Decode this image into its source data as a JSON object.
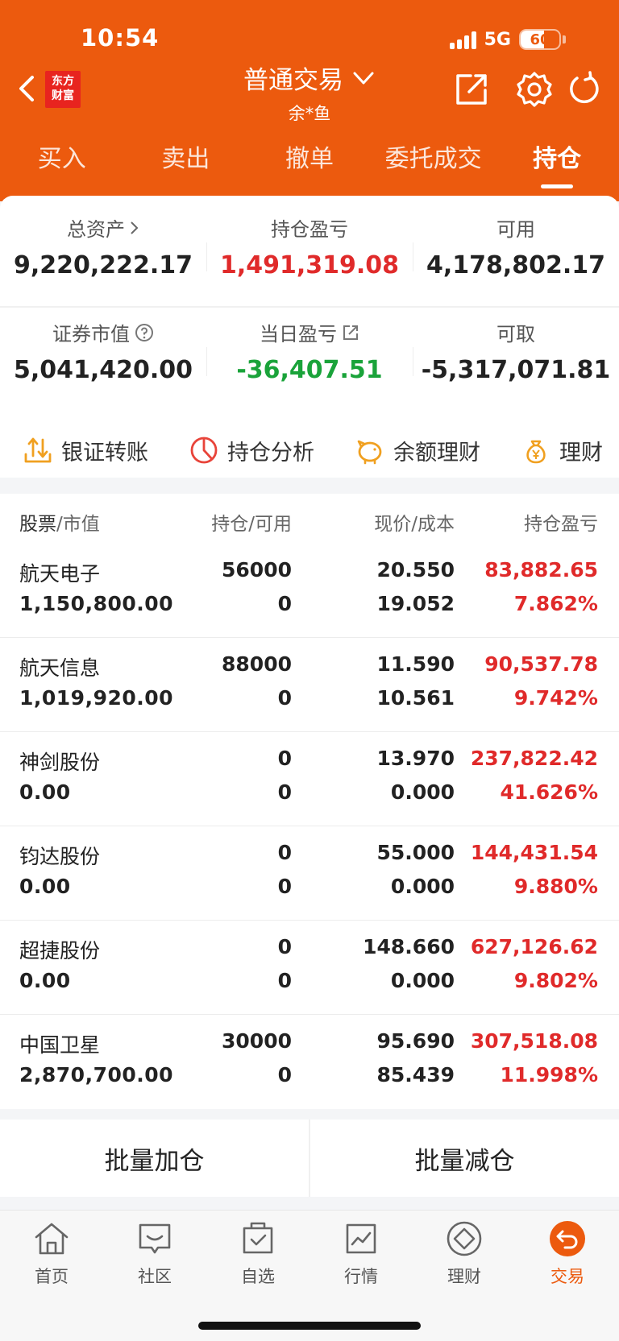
{
  "status": {
    "time": "10:54",
    "network": "5G",
    "battery": "60",
    "battery_fraction": 0.6
  },
  "header": {
    "logo_line1": "东方",
    "logo_line2": "财富",
    "title": "普通交易",
    "subtitle": "余*鱼",
    "icons": [
      "back-icon",
      "share-icon",
      "gear-icon",
      "refresh-icon"
    ]
  },
  "tabs": [
    {
      "label": "买入"
    },
    {
      "label": "卖出"
    },
    {
      "label": "撤单"
    },
    {
      "label": "委托成交"
    },
    {
      "label": "持仓",
      "active": true
    }
  ],
  "summary": {
    "total_assets_label": "总资产",
    "total_assets": "9,220,222.17",
    "position_pl_label": "持仓盈亏",
    "position_pl": "1,491,319.08",
    "available_label": "可用",
    "available": "4,178,802.17",
    "market_value_label": "证券市值",
    "market_value": "5,041,420.00",
    "daily_pl_label": "当日盈亏",
    "daily_pl": "-36,407.51",
    "withdrawable_label": "可取",
    "withdrawable": "-5,317,071.81"
  },
  "quick_actions": [
    {
      "label": "银证转账",
      "icon": "transfer-icon"
    },
    {
      "label": "持仓分析",
      "icon": "pie-chart-icon"
    },
    {
      "label": "余额理财",
      "icon": "piggy-bank-icon"
    },
    {
      "label": "理财",
      "icon": "money-bag-icon"
    }
  ],
  "table": {
    "headers": {
      "stock": "股票",
      "market_value": "/市值",
      "position": "持仓/可用",
      "price": "现价/成本",
      "pl": "持仓盈亏"
    },
    "rows": [
      {
        "name": "航天电子",
        "market_value": "1,150,800.00",
        "hold": "56000",
        "avail": "0",
        "price": "20.550",
        "cost": "19.052",
        "pl": "83,882.65",
        "pl_pct": "7.862%"
      },
      {
        "name": "航天信息",
        "market_value": "1,019,920.00",
        "hold": "88000",
        "avail": "0",
        "price": "11.590",
        "cost": "10.561",
        "pl": "90,537.78",
        "pl_pct": "9.742%"
      },
      {
        "name": "神剑股份",
        "market_value": "0.00",
        "hold": "0",
        "avail": "0",
        "price": "13.970",
        "cost": "0.000",
        "pl": "237,822.42",
        "pl_pct": "41.626%"
      },
      {
        "name": "钧达股份",
        "market_value": "0.00",
        "hold": "0",
        "avail": "0",
        "price": "55.000",
        "cost": "0.000",
        "pl": "144,431.54",
        "pl_pct": "9.880%"
      },
      {
        "name": "超捷股份",
        "market_value": "0.00",
        "hold": "0",
        "avail": "0",
        "price": "148.660",
        "cost": "0.000",
        "pl": "627,126.62",
        "pl_pct": "9.802%"
      },
      {
        "name": "中国卫星",
        "market_value": "2,870,700.00",
        "hold": "30000",
        "avail": "0",
        "price": "95.690",
        "cost": "85.439",
        "pl": "307,518.08",
        "pl_pct": "11.998%"
      }
    ]
  },
  "batch": {
    "add_label": "批量加仓",
    "reduce_label": "批量减仓"
  },
  "nav": [
    {
      "label": "首页",
      "icon": "home-icon"
    },
    {
      "label": "社区",
      "icon": "community-icon"
    },
    {
      "label": "自选",
      "icon": "watchlist-icon"
    },
    {
      "label": "行情",
      "icon": "market-icon"
    },
    {
      "label": "理财",
      "icon": "wealth-icon"
    },
    {
      "label": "交易",
      "icon": "trade-icon",
      "active": true
    }
  ],
  "colors": {
    "brand": "#ec5a0e",
    "gain": "#e02a2a",
    "loss": "#1aa33a"
  }
}
